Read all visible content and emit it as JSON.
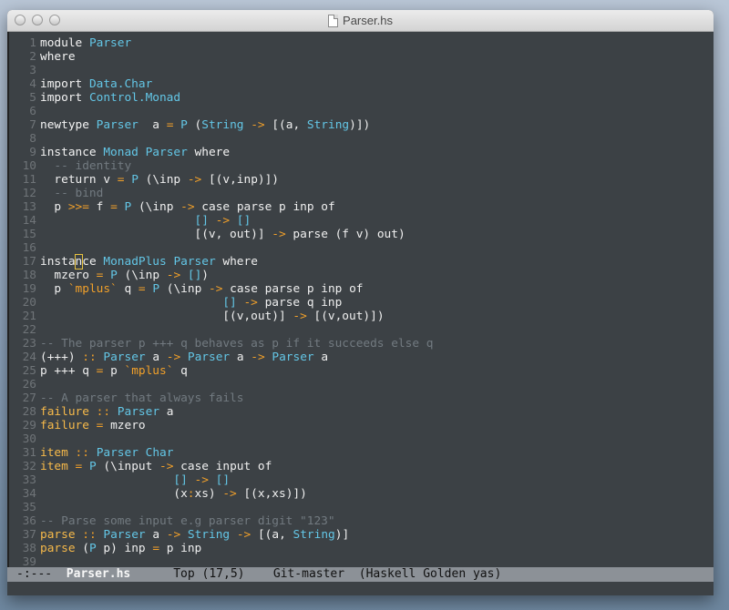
{
  "window": {
    "title": "Parser.hs"
  },
  "code_lines": [
    [
      [
        "kw",
        "module "
      ],
      [
        "ty",
        "Parser"
      ]
    ],
    [
      [
        "kw",
        "where"
      ]
    ],
    [],
    [
      [
        "kw",
        "import "
      ],
      [
        "ty",
        "Data.Char"
      ]
    ],
    [
      [
        "kw",
        "import "
      ],
      [
        "ty",
        "Control.Monad"
      ]
    ],
    [],
    [
      [
        "kw",
        "newtype "
      ],
      [
        "ty",
        "Parser"
      ],
      [
        "",
        "  a "
      ],
      [
        "op",
        "="
      ],
      [
        "",
        ""
      ],
      [
        "ty",
        " P"
      ],
      [
        "",
        " ("
      ],
      [
        "ty",
        "String"
      ],
      [
        "",
        " "
      ],
      [
        "op",
        "->"
      ],
      [
        "",
        " [(a, "
      ],
      [
        "ty",
        "String"
      ],
      [
        "",
        ")])"
      ]
    ],
    [],
    [
      [
        "kw",
        "instance "
      ],
      [
        "ty",
        "Monad"
      ],
      [
        "",
        " "
      ],
      [
        "ty",
        "Parser"
      ],
      [
        "",
        " "
      ],
      [
        "kw",
        "where"
      ]
    ],
    [
      [
        "cm",
        "  -- identity"
      ]
    ],
    [
      [
        "",
        "  return v "
      ],
      [
        "op",
        "="
      ],
      [
        "",
        " "
      ],
      [
        "ty",
        "P"
      ],
      [
        "",
        " (\\inp "
      ],
      [
        "op",
        "->"
      ],
      [
        "",
        " [(v,inp)])"
      ]
    ],
    [
      [
        "cm",
        "  -- bind"
      ]
    ],
    [
      [
        "",
        "  p "
      ],
      [
        "op",
        ">>="
      ],
      [
        "",
        " f "
      ],
      [
        "op",
        "="
      ],
      [
        "",
        " "
      ],
      [
        "ty",
        "P"
      ],
      [
        "",
        " (\\inp "
      ],
      [
        "op",
        "->"
      ],
      [
        "",
        " case parse p inp of"
      ]
    ],
    [
      [
        "",
        "                      "
      ],
      [
        "ty",
        "[]"
      ],
      [
        "",
        " "
      ],
      [
        "op",
        "->"
      ],
      [
        "",
        " "
      ],
      [
        "ty",
        "[]"
      ]
    ],
    [
      [
        "",
        "                      [(v, out)] "
      ],
      [
        "op",
        "->"
      ],
      [
        "",
        " parse (f v) out)"
      ]
    ],
    [],
    [
      [
        "",
        "insta"
      ],
      [
        "cursor",
        "n"
      ],
      [
        "",
        "ce "
      ],
      [
        "ty",
        "MonadPlus"
      ],
      [
        "",
        " "
      ],
      [
        "ty",
        "Parser"
      ],
      [
        "",
        " where"
      ]
    ],
    [
      [
        "",
        "  mzero "
      ],
      [
        "op",
        "="
      ],
      [
        "",
        " "
      ],
      [
        "ty",
        "P"
      ],
      [
        "",
        " (\\inp "
      ],
      [
        "op",
        "->"
      ],
      [
        "",
        " "
      ],
      [
        "ty",
        "[]"
      ],
      [
        "",
        ")"
      ]
    ],
    [
      [
        "",
        "  p "
      ],
      [
        "op",
        "`mplus`"
      ],
      [
        "",
        " q "
      ],
      [
        "op",
        "="
      ],
      [
        "",
        " "
      ],
      [
        "ty",
        "P"
      ],
      [
        "",
        " (\\inp "
      ],
      [
        "op",
        "->"
      ],
      [
        "",
        " case parse p inp of"
      ]
    ],
    [
      [
        "",
        "                          "
      ],
      [
        "ty",
        "[]"
      ],
      [
        "",
        " "
      ],
      [
        "op",
        "->"
      ],
      [
        "",
        " parse q inp"
      ]
    ],
    [
      [
        "",
        "                          [(v,out)] "
      ],
      [
        "op",
        "->"
      ],
      [
        "",
        " [(v,out)])"
      ]
    ],
    [],
    [
      [
        "cm",
        "-- The parser p +++ q behaves as p if it succeeds else q"
      ]
    ],
    [
      [
        "",
        "(+++) "
      ],
      [
        "op",
        "::"
      ],
      [
        "",
        " "
      ],
      [
        "ty",
        "Parser"
      ],
      [
        "",
        " a "
      ],
      [
        "op",
        "->"
      ],
      [
        "",
        " "
      ],
      [
        "ty",
        "Parser"
      ],
      [
        "",
        " a "
      ],
      [
        "op",
        "->"
      ],
      [
        "",
        " "
      ],
      [
        "ty",
        "Parser"
      ],
      [
        "",
        " a"
      ]
    ],
    [
      [
        "",
        "p +++ q "
      ],
      [
        "op",
        "="
      ],
      [
        "",
        " p "
      ],
      [
        "op",
        "`mplus`"
      ],
      [
        "",
        " q"
      ]
    ],
    [],
    [
      [
        "cm",
        "-- A parser that always fails"
      ]
    ],
    [
      [
        "fn",
        "failure"
      ],
      [
        "",
        " "
      ],
      [
        "op",
        "::"
      ],
      [
        "",
        " "
      ],
      [
        "ty",
        "Parser"
      ],
      [
        "",
        " a"
      ]
    ],
    [
      [
        "fn",
        "failure"
      ],
      [
        "",
        " "
      ],
      [
        "op",
        "="
      ],
      [
        "",
        " mzero"
      ]
    ],
    [],
    [
      [
        "fn",
        "item"
      ],
      [
        "",
        " "
      ],
      [
        "op",
        "::"
      ],
      [
        "",
        " "
      ],
      [
        "ty",
        "Parser"
      ],
      [
        "",
        " "
      ],
      [
        "ty",
        "Char"
      ]
    ],
    [
      [
        "fn",
        "item"
      ],
      [
        "",
        " "
      ],
      [
        "op",
        "="
      ],
      [
        "",
        " "
      ],
      [
        "ty",
        "P"
      ],
      [
        "",
        " (\\input "
      ],
      [
        "op",
        "->"
      ],
      [
        "",
        " case input of"
      ]
    ],
    [
      [
        "",
        "                   "
      ],
      [
        "ty",
        "[]"
      ],
      [
        "",
        " "
      ],
      [
        "op",
        "->"
      ],
      [
        "",
        " "
      ],
      [
        "ty",
        "[]"
      ]
    ],
    [
      [
        "",
        "                   (x"
      ],
      [
        "op",
        ":"
      ],
      [
        "",
        "xs) "
      ],
      [
        "op",
        "->"
      ],
      [
        "",
        " [(x,xs)])"
      ]
    ],
    [],
    [
      [
        "cm",
        "-- Parse some input e.g parser digit \"123\""
      ]
    ],
    [
      [
        "fn",
        "parse"
      ],
      [
        "",
        " "
      ],
      [
        "op",
        "::"
      ],
      [
        "",
        " "
      ],
      [
        "ty",
        "Parser"
      ],
      [
        "",
        " a "
      ],
      [
        "op",
        "->"
      ],
      [
        "",
        " "
      ],
      [
        "ty",
        "String"
      ],
      [
        "",
        " "
      ],
      [
        "op",
        "->"
      ],
      [
        "",
        " [(a, "
      ],
      [
        "ty",
        "String"
      ],
      [
        "",
        ")]"
      ]
    ],
    [
      [
        "fn",
        "parse"
      ],
      [
        "",
        " ("
      ],
      [
        "ty",
        "P"
      ],
      [
        "",
        " p) inp "
      ],
      [
        "op",
        "="
      ],
      [
        "",
        " p inp"
      ]
    ],
    []
  ],
  "modeline": {
    "status": "-:---",
    "buffer": "Parser.hs",
    "position": "Top (17,5)",
    "vcs": "Git-master",
    "modes": "(Haskell Golden yas)"
  },
  "colors": {
    "background": "#3c4145",
    "type": "#63c6e6",
    "operator": "#f1a02a",
    "comment": "#727a80",
    "function": "#f6b94a"
  }
}
